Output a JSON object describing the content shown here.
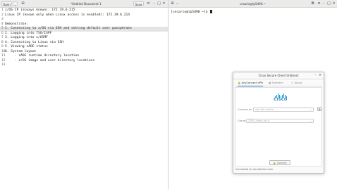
{
  "editor": {
    "open_label": "Open",
    "title": "*Untitled Document 1",
    "save_label": "Save",
    "lines": [
      "z/OS IP (always known): 172.19.6.215",
      "Linux IP (known only when Linux access is enabled): 172.19.6.214",
      "",
      "Demonstrate:",
      "1. Connecting to z/OS via SSH and setting default user passphrase",
      "2. Logging into TSO/ISPF",
      "3. Logging into z/OSMF",
      "4. Connecting to Linux via SSH",
      "5. Viewing zADE status",
      "6. System layout",
      "     - zADE runtime directory location",
      "     - z/OS image and user directory locations",
      ""
    ],
    "current_line": 4
  },
  "terminal": {
    "title": "cesario@lp5d90:~",
    "prompt": "[cesario@lp5d90 ~]$ "
  },
  "vpn": {
    "title": "Cisco Secure Client Umbrest",
    "tabs": [
      "AnyConnect VPN",
      "Statistics",
      "About"
    ],
    "logo_text": "CISCO",
    "connect_to_label": "Connect to:",
    "connect_to_placeholder": "vpn.site.com.br",
    "group_label": "Group:",
    "group_value": "ZTRG_Users_ssl-a",
    "connect_button": "Connect",
    "status": "Connected to vpn.site.ibm.com"
  }
}
